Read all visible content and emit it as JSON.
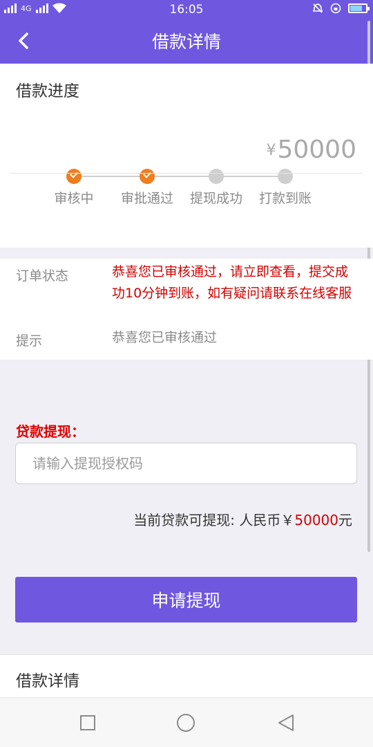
{
  "status_bar": {
    "time": "16:05",
    "network": "4G"
  },
  "header": {
    "title": "借款详情"
  },
  "progress": {
    "section_title": "借款进度",
    "amount_symbol": "¥",
    "amount": "50000",
    "steps": [
      {
        "label": "审核中",
        "state": "done"
      },
      {
        "label": "审批通过",
        "state": "done"
      },
      {
        "label": "提现成功",
        "state": "pending"
      },
      {
        "label": "打款到账",
        "state": "pending"
      }
    ]
  },
  "order": {
    "status_label": "订单状态",
    "status_value": "恭喜您已审核通过，请立即查看，提交成功10分钟到账，如有疑问请联系在线客服",
    "tip_label": "提示",
    "tip_value": "恭喜您已审核通过"
  },
  "withdraw": {
    "label": "贷款提现：",
    "input_placeholder": "请输入提现授权码",
    "input_value": "",
    "available_prefix": "当前贷款可提现: 人民币￥",
    "available_amount": "50000",
    "available_suffix": "元",
    "button_label": "申请提现"
  },
  "detail": {
    "section_title": "借款详情"
  },
  "colors": {
    "primary": "#6f57e0",
    "accent_red": "#d00000",
    "step_done": "#f07d1e",
    "step_pending": "#cfcfcf"
  }
}
